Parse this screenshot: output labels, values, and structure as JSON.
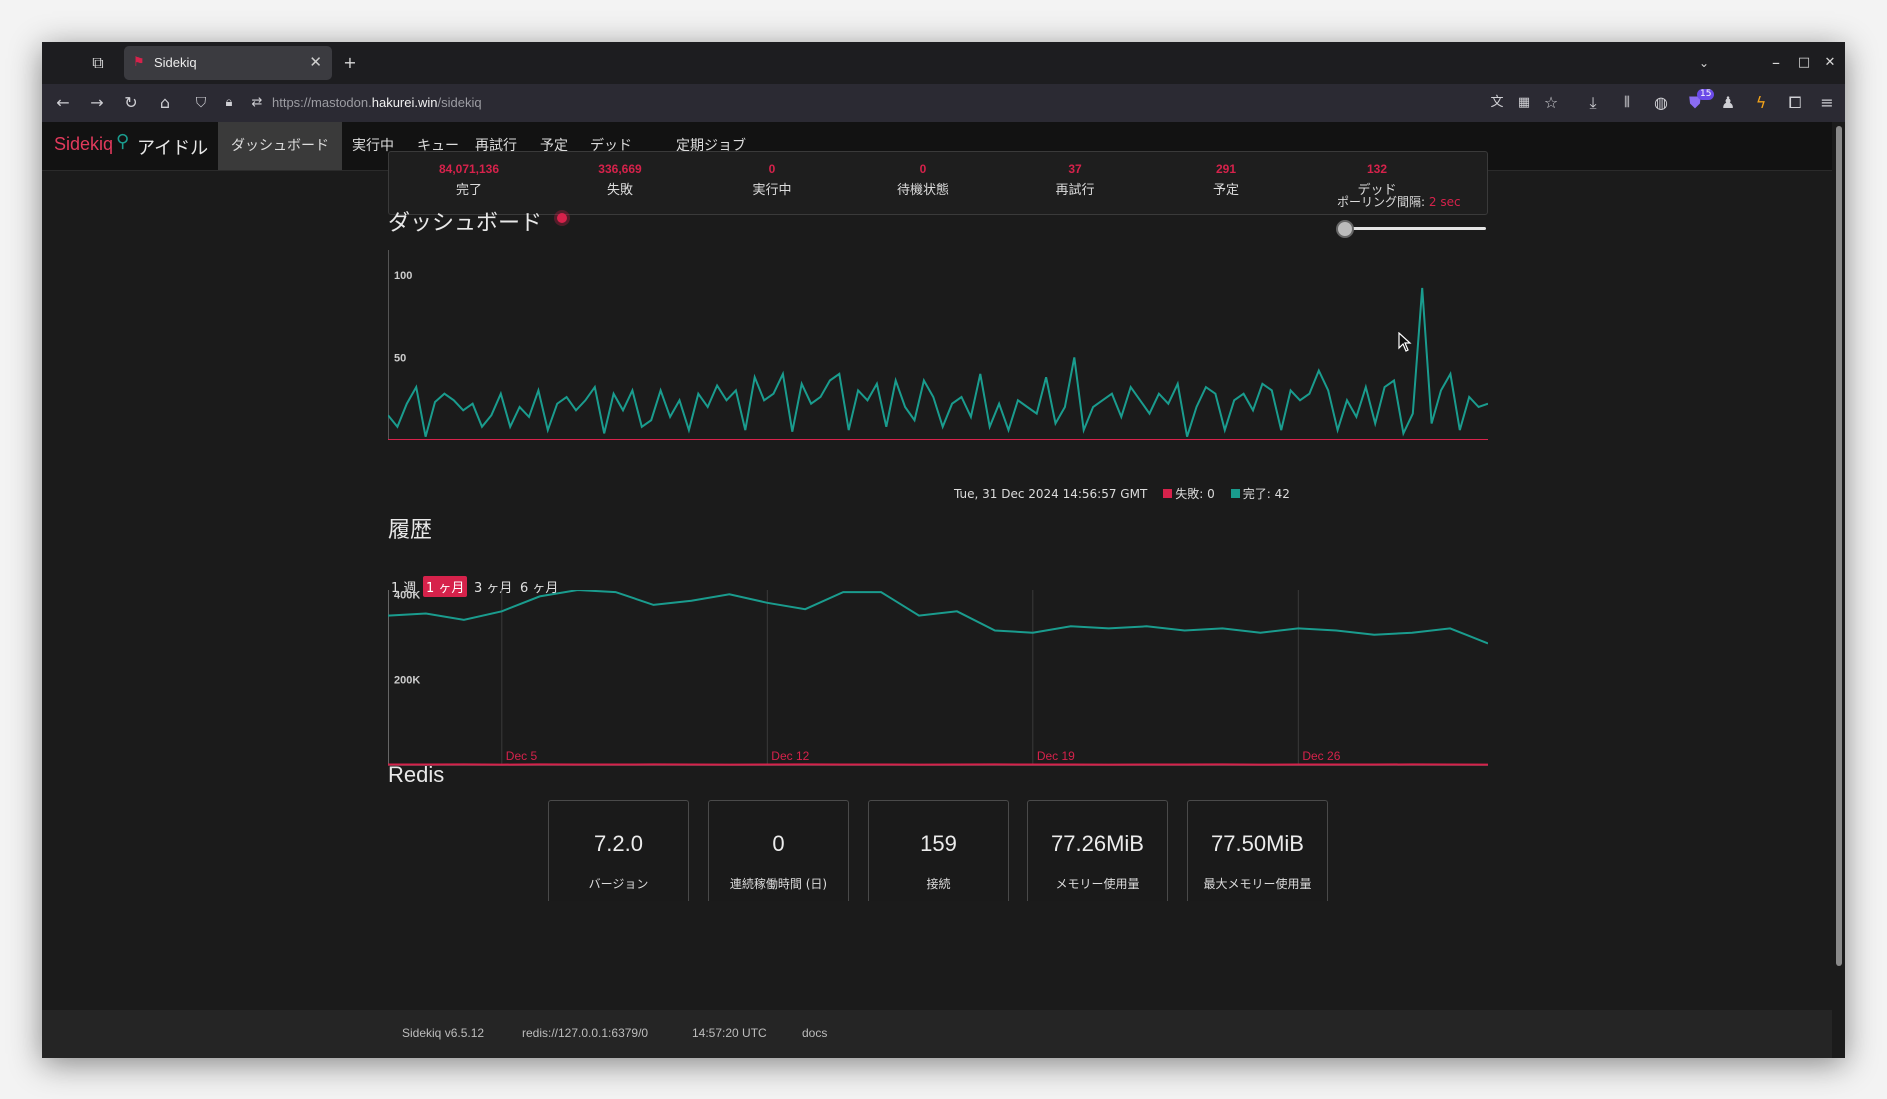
{
  "browser": {
    "tab_title": "Sidekiq",
    "url_prefix": "https://mastodon.",
    "url_host": "hakurei.win",
    "url_path": "/sidekiq",
    "extension_badge": "15"
  },
  "app": {
    "brand": "Sidekiq",
    "status": "アイドル",
    "nav": [
      {
        "label": "ダッシュボード",
        "active": true
      },
      {
        "label": "実行中"
      },
      {
        "label": "キュー"
      },
      {
        "label": "再試行"
      },
      {
        "label": "予定"
      },
      {
        "label": "デッド"
      },
      {
        "label": "定期ジョブ"
      }
    ]
  },
  "summary": [
    {
      "value": "84,071,136",
      "label": "完了"
    },
    {
      "value": "336,669",
      "label": "失敗"
    },
    {
      "value": "0",
      "label": "実行中"
    },
    {
      "value": "0",
      "label": "待機状態"
    },
    {
      "value": "37",
      "label": "再試行"
    },
    {
      "value": "291",
      "label": "予定"
    },
    {
      "value": "132",
      "label": "デッド"
    }
  ],
  "dashboard": {
    "title": "ダッシュボード",
    "poll_label": "ポーリング間隔:",
    "poll_value": "2 sec",
    "poll_fraction": 0.0
  },
  "realtime_legend": {
    "timestamp": "Tue, 31 Dec 2024 14:56:57 GMT",
    "failed": "失敗: 0",
    "processed": "完了: 42",
    "failed_color": "#d6224b",
    "processed_color": "#1a9c8e"
  },
  "history": {
    "title": "履歴",
    "ranges": [
      {
        "label": "1 週"
      },
      {
        "label": "1 ヶ月",
        "active": true
      },
      {
        "label": "3 ヶ月"
      },
      {
        "label": "6 ヶ月"
      }
    ]
  },
  "chart_data": [
    {
      "type": "line",
      "yticks": [
        50,
        100
      ],
      "ylim": [
        0,
        115
      ],
      "grid": false,
      "series": [
        {
          "name": "完了",
          "color": "#1a9c8e",
          "values": [
            15,
            8,
            22,
            32,
            2,
            23,
            28,
            24,
            18,
            22,
            8,
            15,
            28,
            8,
            20,
            14,
            30,
            6,
            22,
            26,
            18,
            24,
            32,
            4,
            28,
            18,
            30,
            8,
            12,
            30,
            14,
            24,
            6,
            28,
            20,
            33,
            24,
            30,
            6,
            38,
            24,
            28,
            40,
            5,
            34,
            22,
            26,
            36,
            40,
            6,
            30,
            24,
            34,
            8,
            36,
            20,
            12,
            36,
            26,
            8,
            22,
            26,
            14,
            40,
            8,
            22,
            6,
            24,
            20,
            16,
            38,
            10,
            20,
            50,
            6,
            20,
            24,
            28,
            14,
            32,
            24,
            16,
            28,
            22,
            34,
            2,
            20,
            32,
            28,
            6,
            24,
            28,
            18,
            34,
            30,
            6,
            30,
            24,
            28,
            42,
            30,
            6,
            24,
            14,
            32,
            10,
            32,
            36,
            4,
            16,
            92,
            10,
            30,
            40,
            6,
            26,
            20,
            22
          ]
        },
        {
          "name": "失敗",
          "color": "#d6224b",
          "values": [
            0,
            0,
            0,
            0,
            0,
            0,
            0,
            0,
            0,
            0,
            0,
            0,
            0,
            0,
            0,
            0,
            0,
            0,
            0,
            0,
            0,
            0,
            0,
            0,
            0,
            0,
            0,
            0,
            0,
            0,
            0,
            0,
            0,
            0,
            0,
            0,
            0,
            0,
            0,
            0,
            0,
            0,
            0,
            0,
            0,
            0,
            0,
            0,
            0,
            0,
            0,
            0,
            0,
            0,
            0,
            0,
            0,
            0,
            0,
            0,
            0,
            0,
            0,
            0,
            0,
            0,
            0,
            0,
            0,
            0,
            0,
            0,
            0,
            0,
            0,
            0,
            0,
            0,
            0,
            0,
            0,
            0,
            0,
            0,
            0,
            0,
            0,
            0,
            0,
            0,
            0,
            0,
            0,
            0,
            0,
            0,
            0,
            0,
            0,
            0,
            0,
            0,
            0,
            0,
            0,
            0,
            0,
            0,
            0,
            0,
            0,
            0,
            0,
            0,
            0,
            0,
            0,
            0
          ]
        }
      ]
    },
    {
      "type": "line",
      "ytick_labels": [
        "200K",
        "400K"
      ],
      "ytick_values": [
        200000,
        400000
      ],
      "ylim": [
        0,
        410000
      ],
      "xtick_labels": [
        "Dec 5",
        "Dec 12",
        "Dec 19",
        "Dec 26"
      ],
      "xtick_index": [
        3,
        10,
        17,
        24
      ],
      "series": [
        {
          "name": "完了",
          "color": "#1a9c8e",
          "values": [
            350000,
            355000,
            340000,
            360000,
            395000,
            410000,
            405000,
            375000,
            385000,
            400000,
            380000,
            365000,
            405000,
            405000,
            350000,
            360000,
            315000,
            310000,
            325000,
            320000,
            325000,
            315000,
            320000,
            310000,
            320000,
            315000,
            305000,
            310000,
            320000,
            285000
          ]
        },
        {
          "name": "失敗",
          "color": "#d6224b",
          "values": [
            1200,
            1100,
            1300,
            1000,
            1400,
            1200,
            1100,
            1300,
            1200,
            1000,
            1100,
            1300,
            1200,
            1100,
            1000,
            1200,
            1300,
            1100,
            1200,
            1000,
            1100,
            1200,
            1300,
            1000,
            1100,
            1200,
            1100,
            1300,
            1200,
            1000
          ]
        }
      ]
    }
  ],
  "redis": {
    "title": "Redis",
    "stats": [
      {
        "value": "7.2.0",
        "label": "バージョン"
      },
      {
        "value": "0",
        "label": "連続稼働時間 (日)"
      },
      {
        "value": "159",
        "label": "接続"
      },
      {
        "value": "77.26MiB",
        "label": "メモリー使用量"
      },
      {
        "value": "77.50MiB",
        "label": "最大メモリー使用量"
      }
    ]
  },
  "footer": {
    "version": "Sidekiq v6.5.12",
    "redis_url": "redis://127.0.0.1:6379/0",
    "time": "14:57:20 UTC",
    "docs": "docs"
  }
}
